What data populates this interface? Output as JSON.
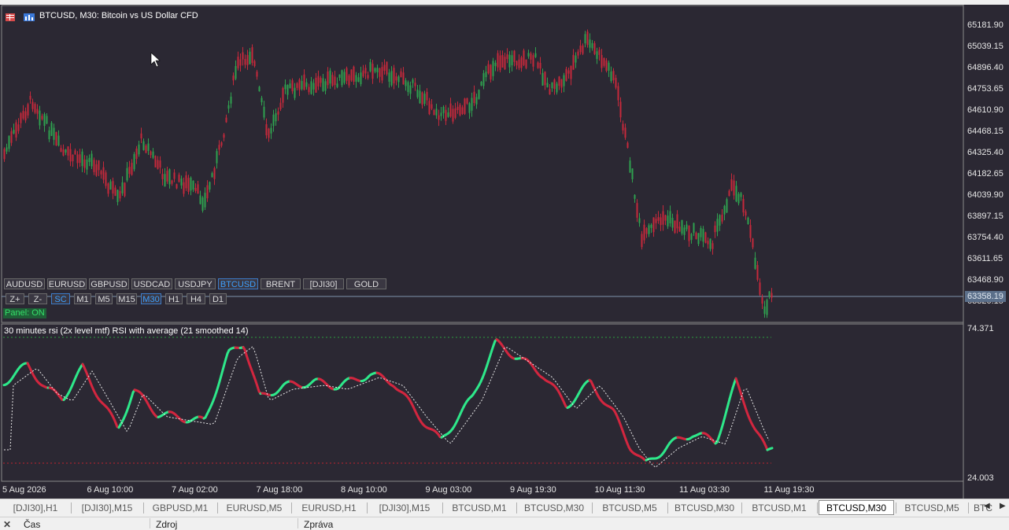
{
  "chart": {
    "title": "BTCUSD, M30:  Bitcoin vs US Dollar CFD",
    "price_labels": [
      "65181.90",
      "65039.15",
      "64896.40",
      "64753.65",
      "64610.90",
      "64468.15",
      "64325.40",
      "64182.65",
      "64039.90",
      "63897.15",
      "63754.40",
      "63611.65",
      "63468.90",
      "63320.15"
    ],
    "current_price": "63358.19",
    "date_labels": [
      "5 Aug 2026",
      "6 Aug 10:00",
      "7 Aug 02:00",
      "7 Aug 18:00",
      "8 Aug 10:00",
      "9 Aug 03:00",
      "9 Aug 19:30",
      "10 Aug 11:30",
      "11 Aug 03:30",
      "11 Aug 19:30"
    ],
    "colors": {
      "bull": "#2fa14f",
      "bear": "#c5293b",
      "background": "#2b2833",
      "rsi_up": "#2ee88a",
      "rsi_down": "#d2263f",
      "level_high": "#2e9e3f",
      "level_low": "#c0242f"
    }
  },
  "symbols": [
    "AUDUSD",
    "EURUSD",
    "GBPUSD",
    "USDCAD",
    "USDJPY",
    "BTCUSD",
    "BRENT",
    "[DJI30]",
    "GOLD"
  ],
  "active_symbol": "BTCUSD",
  "timeframes": [
    "Z+",
    "Z-",
    "SC",
    "M1",
    "M5",
    "M15",
    "M30",
    "H1",
    "H4",
    "D1"
  ],
  "active_timeframes": [
    "SC",
    "M30"
  ],
  "panel_status": "Panel: ON",
  "indicator": {
    "title": "30 minutes rsi (2x level mtf) RSI with average (21 smoothed 14)",
    "level_high": "74.371",
    "level_low": "24.003"
  },
  "tabs": [
    "[DJI30],H1",
    "[DJI30],M15",
    "GBPUSD,M1",
    "EURUSD,M5",
    "EURUSD,H1",
    "[DJI30],M15",
    "BTCUSD,M1",
    "BTCUSD,M30",
    "BTCUSD,M5",
    "BTCUSD,M30",
    "BTCUSD,M1",
    "BTCUSD,M30",
    "BTCUSD,M5",
    "BTC"
  ],
  "active_tab_index": 11,
  "bottom_columns": [
    "Čas",
    "Zdroj",
    "Zpráva"
  ],
  "icons": {
    "close": "close-icon",
    "tab_left": "arrow-left-icon",
    "tab_right": "arrow-right-icon"
  }
}
